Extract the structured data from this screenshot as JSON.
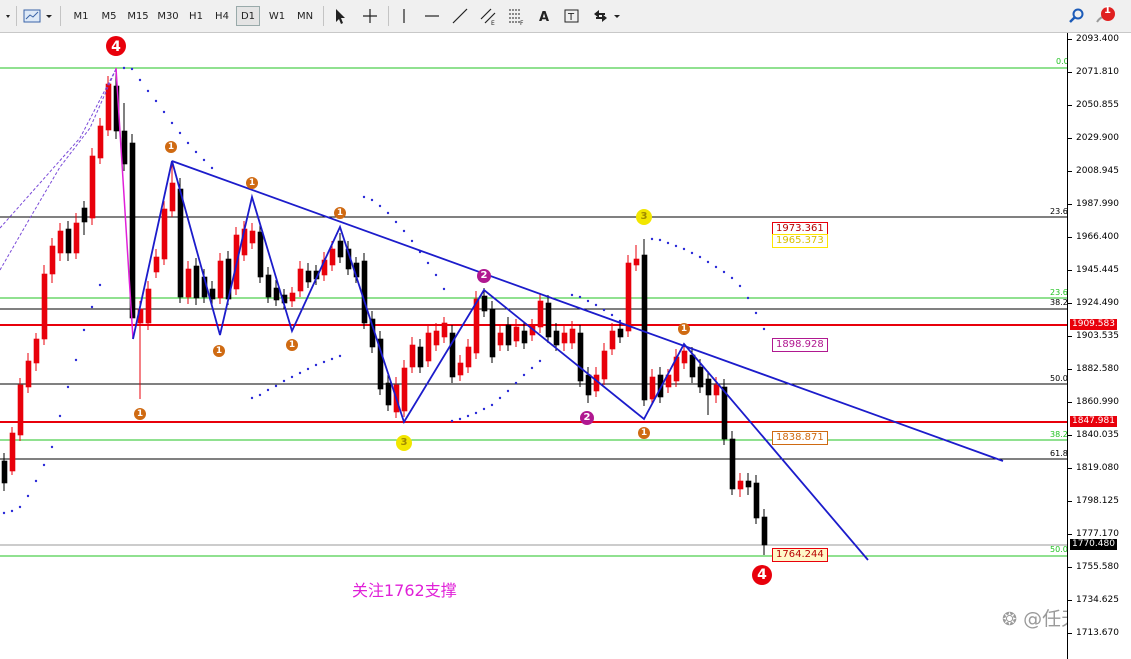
{
  "toolbar": {
    "timeframes": [
      "M1",
      "M5",
      "M15",
      "M30",
      "H1",
      "H4",
      "D1",
      "W1",
      "MN"
    ],
    "active_timeframe": "D1",
    "notification_count": "1"
  },
  "price_axis": {
    "ticks": [
      "2093.400",
      "2071.810",
      "2050.855",
      "2029.900",
      "2008.945",
      "1987.990",
      "1966.400",
      "1945.445",
      "1924.490",
      "1903.535",
      "1882.580",
      "1860.990",
      "1840.035",
      "1819.080",
      "1798.125",
      "1777.170",
      "1755.580",
      "1734.625",
      "1713.670"
    ],
    "current_price": "1770.480",
    "red_line_price": "1909.583",
    "red_line_price_2": "1847.981",
    "level_labels": [
      "0.0",
      "23.6",
      "23.6",
      "38.2",
      "50.0",
      "38.2",
      "61.8",
      "50.0"
    ]
  },
  "chart_boxes": {
    "box1": "1973.361",
    "box2": "1965.373",
    "box3": "1898.928",
    "box4": "1838.871",
    "box5": "1764.244"
  },
  "wave_labels": {
    "top_four": "4",
    "bottom_four": "4",
    "one": "1",
    "two": "2",
    "three": "3"
  },
  "annotation": "关注1762支撑",
  "watermark": "@任天成",
  "colors": {
    "bull": "#e8000b",
    "bear": "#000000",
    "channel": "#1c1ccb",
    "fib_green": "#22c322",
    "support_red": "#e8000b",
    "sar": "#2a2ad8",
    "annotation": "#e020d8"
  }
}
